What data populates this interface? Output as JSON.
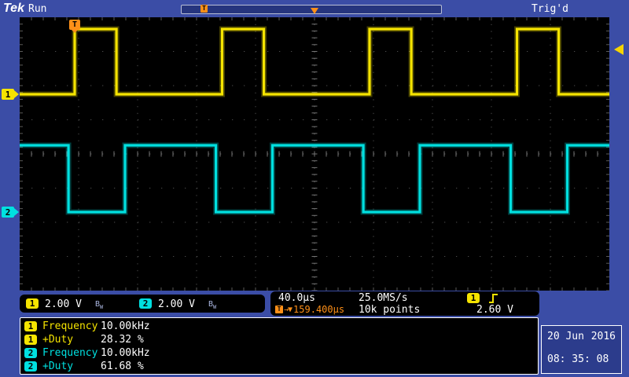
{
  "header": {
    "brand": "Tek",
    "acq_status": "Run",
    "trig_status": "Trig'd",
    "record_bar": {
      "trigger_marker": "T"
    }
  },
  "display": {
    "trigger_time_marker": "T"
  },
  "channels": [
    {
      "id": "1",
      "scale": "2.00 V",
      "bw_b": "B",
      "bw_w": "W",
      "color": "#f5e400"
    },
    {
      "id": "2",
      "scale": "2.00 V",
      "bw_b": "B",
      "bw_w": "W",
      "color": "#00e0e0"
    }
  ],
  "horizontal": {
    "scale": "40.0µs",
    "sample_rate": "25.0MS/s",
    "delay_marker": "T",
    "delay": "159.400µs",
    "record_length": "10k points"
  },
  "trigger": {
    "source": "1",
    "level": "2.60 V",
    "slope": "rising"
  },
  "measurements": [
    {
      "ch": "1",
      "label": "Frequency",
      "value": "10.00kHz"
    },
    {
      "ch": "1",
      "label": "+Duty",
      "value": "28.32 %"
    },
    {
      "ch": "2",
      "label": "Frequency",
      "value": "10.00kHz"
    },
    {
      "ch": "2",
      "label": "+Duty",
      "value": "61.68 %"
    }
  ],
  "datetime": {
    "date": "20 Jun",
    "year": "2016",
    "time": "08: 35: 08"
  },
  "chart_data": {
    "type": "line",
    "title": "Oscilloscope square-wave traces",
    "time_per_div": "40.0µs",
    "volts_per_div": "2.00 V",
    "divisions": {
      "x": 10,
      "y": 8
    },
    "series": [
      {
        "name": "CH1",
        "color": "#f5e400",
        "shape": "square",
        "frequency": "10.00kHz",
        "duty_pct": 28.32,
        "px": {
          "first_rise": 70,
          "period": 187.5,
          "high_width": 53.1,
          "y_high": 15,
          "y_low": 98
        }
      },
      {
        "name": "CH2",
        "color": "#00e0e0",
        "shape": "square",
        "frequency": "10.00kHz",
        "duty_pct": 61.68,
        "px": {
          "first_rise": 134,
          "period": 187.5,
          "high_width": 115.6,
          "y_high": 163,
          "y_low": 248
        }
      }
    ]
  }
}
